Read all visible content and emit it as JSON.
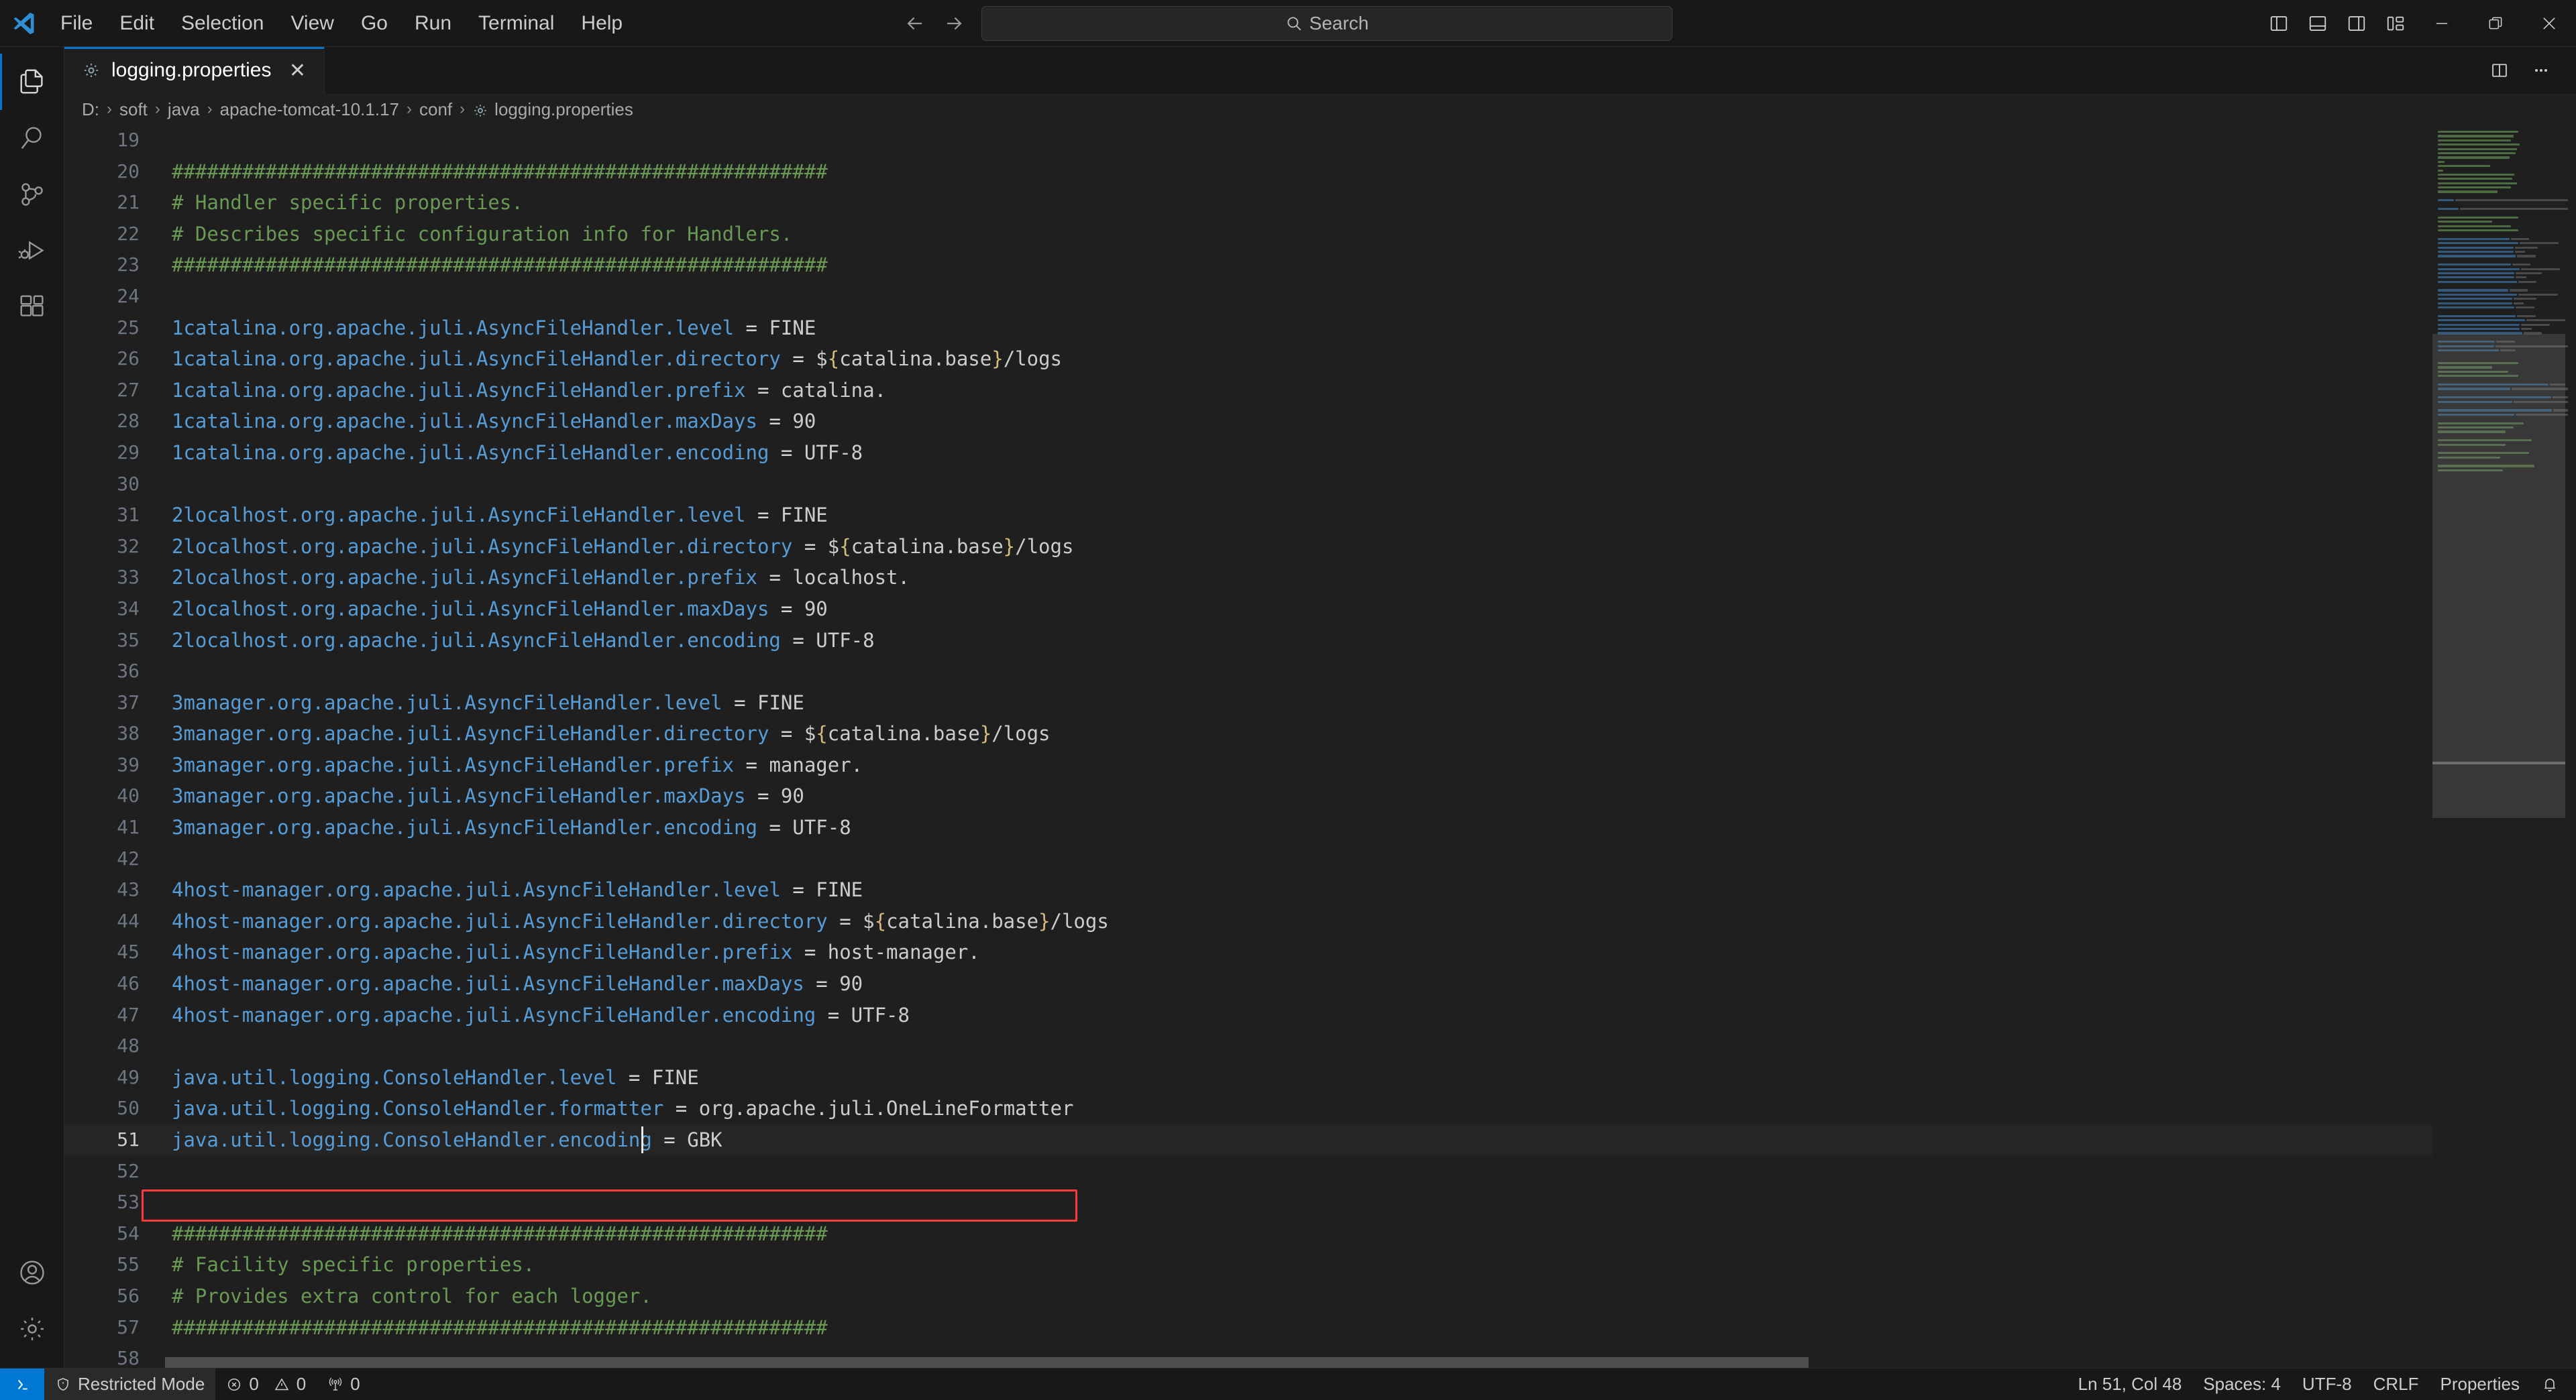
{
  "window": {
    "app": "Visual Studio Code",
    "logo_icon": "vscode-logo-icon"
  },
  "menubar": {
    "items": [
      {
        "label": "File",
        "name": "menu-file"
      },
      {
        "label": "Edit",
        "name": "menu-edit"
      },
      {
        "label": "Selection",
        "name": "menu-selection"
      },
      {
        "label": "View",
        "name": "menu-view"
      },
      {
        "label": "Go",
        "name": "menu-go"
      },
      {
        "label": "Run",
        "name": "menu-run"
      },
      {
        "label": "Terminal",
        "name": "menu-terminal"
      },
      {
        "label": "Help",
        "name": "menu-help"
      }
    ]
  },
  "titlebar": {
    "back_icon": "arrow-left-icon",
    "forward_icon": "arrow-right-icon",
    "search_label": "Search",
    "search_icon": "search-icon",
    "layout_icons": [
      {
        "name": "toggle-primary-sidebar-icon"
      },
      {
        "name": "toggle-panel-icon"
      },
      {
        "name": "toggle-secondary-sidebar-icon"
      },
      {
        "name": "customize-layout-icon"
      }
    ],
    "window_controls": [
      {
        "name": "minimize-button"
      },
      {
        "name": "restore-button"
      },
      {
        "name": "close-button"
      }
    ]
  },
  "activitybar": {
    "items": [
      {
        "name": "activity-explorer",
        "icon": "files-icon",
        "active": true
      },
      {
        "name": "activity-search",
        "icon": "search-icon",
        "active": false
      },
      {
        "name": "activity-source-control",
        "icon": "source-control-icon",
        "active": false
      },
      {
        "name": "activity-run-debug",
        "icon": "run-and-debug-icon",
        "active": false
      },
      {
        "name": "activity-extensions",
        "icon": "extensions-icon",
        "active": false
      }
    ],
    "bottom": [
      {
        "name": "activity-accounts",
        "icon": "account-icon"
      },
      {
        "name": "activity-settings",
        "icon": "gear-icon"
      }
    ]
  },
  "tabs": {
    "items": [
      {
        "label": "logging.properties",
        "icon": "properties-file-icon",
        "active": true,
        "close_glyph": "✕"
      }
    ],
    "actions": [
      {
        "name": "split-editor-right-button",
        "icon": "split-editor-icon"
      },
      {
        "name": "more-actions-button",
        "icon": "ellipsis-icon",
        "glyph": "⋯"
      }
    ]
  },
  "breadcrumbs": {
    "separator": "›",
    "file_icon": "properties-file-icon",
    "items": [
      "D:",
      "soft",
      "java",
      "apache-tomcat-10.1.17",
      "conf",
      "logging.properties"
    ]
  },
  "editor": {
    "first_line": 19,
    "current_line": 51,
    "annotation": {
      "type": "red-rectangle",
      "target_line": 51,
      "color": "#fb3b3b"
    },
    "lines": [
      {
        "n": 19,
        "tokens": []
      },
      {
        "n": 20,
        "tokens": [
          {
            "t": "comment",
            "v": "########################################################"
          }
        ]
      },
      {
        "n": 21,
        "tokens": [
          {
            "t": "comment",
            "v": "# Handler specific properties."
          }
        ]
      },
      {
        "n": 22,
        "tokens": [
          {
            "t": "comment",
            "v": "# Describes specific configuration info for Handlers."
          }
        ]
      },
      {
        "n": 23,
        "tokens": [
          {
            "t": "comment",
            "v": "########################################################"
          }
        ]
      },
      {
        "n": 24,
        "tokens": []
      },
      {
        "n": 25,
        "tokens": [
          {
            "t": "key",
            "v": "1catalina.org.apache.juli.AsyncFileHandler.level"
          },
          {
            "t": "eq",
            "v": " = "
          },
          {
            "t": "val",
            "v": "FINE"
          }
        ]
      },
      {
        "n": 26,
        "tokens": [
          {
            "t": "key",
            "v": "1catalina.org.apache.juli.AsyncFileHandler.directory"
          },
          {
            "t": "eq",
            "v": " = "
          },
          {
            "t": "val",
            "v": "$"
          },
          {
            "t": "brace",
            "v": "{"
          },
          {
            "t": "val",
            "v": "catalina.base"
          },
          {
            "t": "brace",
            "v": "}"
          },
          {
            "t": "val",
            "v": "/logs"
          }
        ]
      },
      {
        "n": 27,
        "tokens": [
          {
            "t": "key",
            "v": "1catalina.org.apache.juli.AsyncFileHandler.prefix"
          },
          {
            "t": "eq",
            "v": " = "
          },
          {
            "t": "val",
            "v": "catalina."
          }
        ]
      },
      {
        "n": 28,
        "tokens": [
          {
            "t": "key",
            "v": "1catalina.org.apache.juli.AsyncFileHandler.maxDays"
          },
          {
            "t": "eq",
            "v": " = "
          },
          {
            "t": "val",
            "v": "90"
          }
        ]
      },
      {
        "n": 29,
        "tokens": [
          {
            "t": "key",
            "v": "1catalina.org.apache.juli.AsyncFileHandler.encoding"
          },
          {
            "t": "eq",
            "v": " = "
          },
          {
            "t": "val",
            "v": "UTF-8"
          }
        ]
      },
      {
        "n": 30,
        "tokens": []
      },
      {
        "n": 31,
        "tokens": [
          {
            "t": "key",
            "v": "2localhost.org.apache.juli.AsyncFileHandler.level"
          },
          {
            "t": "eq",
            "v": " = "
          },
          {
            "t": "val",
            "v": "FINE"
          }
        ]
      },
      {
        "n": 32,
        "tokens": [
          {
            "t": "key",
            "v": "2localhost.org.apache.juli.AsyncFileHandler.directory"
          },
          {
            "t": "eq",
            "v": " = "
          },
          {
            "t": "val",
            "v": "$"
          },
          {
            "t": "brace",
            "v": "{"
          },
          {
            "t": "val",
            "v": "catalina.base"
          },
          {
            "t": "brace",
            "v": "}"
          },
          {
            "t": "val",
            "v": "/logs"
          }
        ]
      },
      {
        "n": 33,
        "tokens": [
          {
            "t": "key",
            "v": "2localhost.org.apache.juli.AsyncFileHandler.prefix"
          },
          {
            "t": "eq",
            "v": " = "
          },
          {
            "t": "val",
            "v": "localhost."
          }
        ]
      },
      {
        "n": 34,
        "tokens": [
          {
            "t": "key",
            "v": "2localhost.org.apache.juli.AsyncFileHandler.maxDays"
          },
          {
            "t": "eq",
            "v": " = "
          },
          {
            "t": "val",
            "v": "90"
          }
        ]
      },
      {
        "n": 35,
        "tokens": [
          {
            "t": "key",
            "v": "2localhost.org.apache.juli.AsyncFileHandler.encoding"
          },
          {
            "t": "eq",
            "v": " = "
          },
          {
            "t": "val",
            "v": "UTF-8"
          }
        ]
      },
      {
        "n": 36,
        "tokens": []
      },
      {
        "n": 37,
        "tokens": [
          {
            "t": "key",
            "v": "3manager.org.apache.juli.AsyncFileHandler.level"
          },
          {
            "t": "eq",
            "v": " = "
          },
          {
            "t": "val",
            "v": "FINE"
          }
        ]
      },
      {
        "n": 38,
        "tokens": [
          {
            "t": "key",
            "v": "3manager.org.apache.juli.AsyncFileHandler.directory"
          },
          {
            "t": "eq",
            "v": " = "
          },
          {
            "t": "val",
            "v": "$"
          },
          {
            "t": "brace",
            "v": "{"
          },
          {
            "t": "val",
            "v": "catalina.base"
          },
          {
            "t": "brace",
            "v": "}"
          },
          {
            "t": "val",
            "v": "/logs"
          }
        ]
      },
      {
        "n": 39,
        "tokens": [
          {
            "t": "key",
            "v": "3manager.org.apache.juli.AsyncFileHandler.prefix"
          },
          {
            "t": "eq",
            "v": " = "
          },
          {
            "t": "val",
            "v": "manager."
          }
        ]
      },
      {
        "n": 40,
        "tokens": [
          {
            "t": "key",
            "v": "3manager.org.apache.juli.AsyncFileHandler.maxDays"
          },
          {
            "t": "eq",
            "v": " = "
          },
          {
            "t": "val",
            "v": "90"
          }
        ]
      },
      {
        "n": 41,
        "tokens": [
          {
            "t": "key",
            "v": "3manager.org.apache.juli.AsyncFileHandler.encoding"
          },
          {
            "t": "eq",
            "v": " = "
          },
          {
            "t": "val",
            "v": "UTF-8"
          }
        ]
      },
      {
        "n": 42,
        "tokens": []
      },
      {
        "n": 43,
        "tokens": [
          {
            "t": "key",
            "v": "4host-manager.org.apache.juli.AsyncFileHandler.level"
          },
          {
            "t": "eq",
            "v": " = "
          },
          {
            "t": "val",
            "v": "FINE"
          }
        ]
      },
      {
        "n": 44,
        "tokens": [
          {
            "t": "key",
            "v": "4host-manager.org.apache.juli.AsyncFileHandler.directory"
          },
          {
            "t": "eq",
            "v": " = "
          },
          {
            "t": "val",
            "v": "$"
          },
          {
            "t": "brace",
            "v": "{"
          },
          {
            "t": "val",
            "v": "catalina.base"
          },
          {
            "t": "brace",
            "v": "}"
          },
          {
            "t": "val",
            "v": "/logs"
          }
        ]
      },
      {
        "n": 45,
        "tokens": [
          {
            "t": "key",
            "v": "4host-manager.org.apache.juli.AsyncFileHandler.prefix"
          },
          {
            "t": "eq",
            "v": " = "
          },
          {
            "t": "val",
            "v": "host-manager."
          }
        ]
      },
      {
        "n": 46,
        "tokens": [
          {
            "t": "key",
            "v": "4host-manager.org.apache.juli.AsyncFileHandler.maxDays"
          },
          {
            "t": "eq",
            "v": " = "
          },
          {
            "t": "val",
            "v": "90"
          }
        ]
      },
      {
        "n": 47,
        "tokens": [
          {
            "t": "key",
            "v": "4host-manager.org.apache.juli.AsyncFileHandler.encoding"
          },
          {
            "t": "eq",
            "v": " = "
          },
          {
            "t": "val",
            "v": "UTF-8"
          }
        ]
      },
      {
        "n": 48,
        "tokens": []
      },
      {
        "n": 49,
        "tokens": [
          {
            "t": "key",
            "v": "java.util.logging.ConsoleHandler.level"
          },
          {
            "t": "eq",
            "v": " = "
          },
          {
            "t": "val",
            "v": "FINE"
          }
        ]
      },
      {
        "n": 50,
        "tokens": [
          {
            "t": "key",
            "v": "java.util.logging.ConsoleHandler.formatter"
          },
          {
            "t": "eq",
            "v": " = "
          },
          {
            "t": "val",
            "v": "org.apache.juli.OneLineFormatter"
          }
        ]
      },
      {
        "n": 51,
        "tokens": [
          {
            "t": "key",
            "v": "java.util.logging.ConsoleHandler.encoding"
          },
          {
            "t": "eq",
            "v": " = "
          },
          {
            "t": "val",
            "v": "GBK"
          }
        ],
        "current": true
      },
      {
        "n": 52,
        "tokens": []
      },
      {
        "n": 53,
        "tokens": []
      },
      {
        "n": 54,
        "tokens": [
          {
            "t": "comment",
            "v": "########################################################"
          }
        ]
      },
      {
        "n": 55,
        "tokens": [
          {
            "t": "comment",
            "v": "# Facility specific properties."
          }
        ]
      },
      {
        "n": 56,
        "tokens": [
          {
            "t": "comment",
            "v": "# Provides extra control for each logger."
          }
        ]
      },
      {
        "n": 57,
        "tokens": [
          {
            "t": "comment",
            "v": "########################################################"
          }
        ]
      },
      {
        "n": 58,
        "tokens": []
      }
    ],
    "colors": {
      "background": "#1f1f1f",
      "comment": "#6a9955",
      "key": "#569cd6",
      "value": "#cccccc",
      "brace": "#d7ba7d",
      "line_number": "#6e7681",
      "current_line": "#252525"
    }
  },
  "minimap": {
    "enabled": true,
    "slider_visible": true
  },
  "statusbar": {
    "remote": {
      "label": "",
      "icon": "remote-indicator-icon"
    },
    "left": [
      {
        "name": "restricted-mode",
        "icon": "shield-icon",
        "label": "Restricted Mode",
        "shaded": true
      },
      {
        "name": "problems",
        "icon": "error-icon",
        "label": "0",
        "icon2": "warning-icon",
        "label2": "0"
      },
      {
        "name": "ports",
        "icon": "radio-tower-icon",
        "label": "0"
      }
    ],
    "right": [
      {
        "name": "editor-position",
        "label": "Ln 51, Col 48"
      },
      {
        "name": "editor-indentation",
        "label": "Spaces: 4"
      },
      {
        "name": "editor-encoding",
        "label": "UTF-8"
      },
      {
        "name": "editor-eol",
        "label": "CRLF"
      },
      {
        "name": "editor-language",
        "label": "Properties"
      },
      {
        "name": "notifications",
        "icon": "bell-icon",
        "label": ""
      }
    ]
  }
}
